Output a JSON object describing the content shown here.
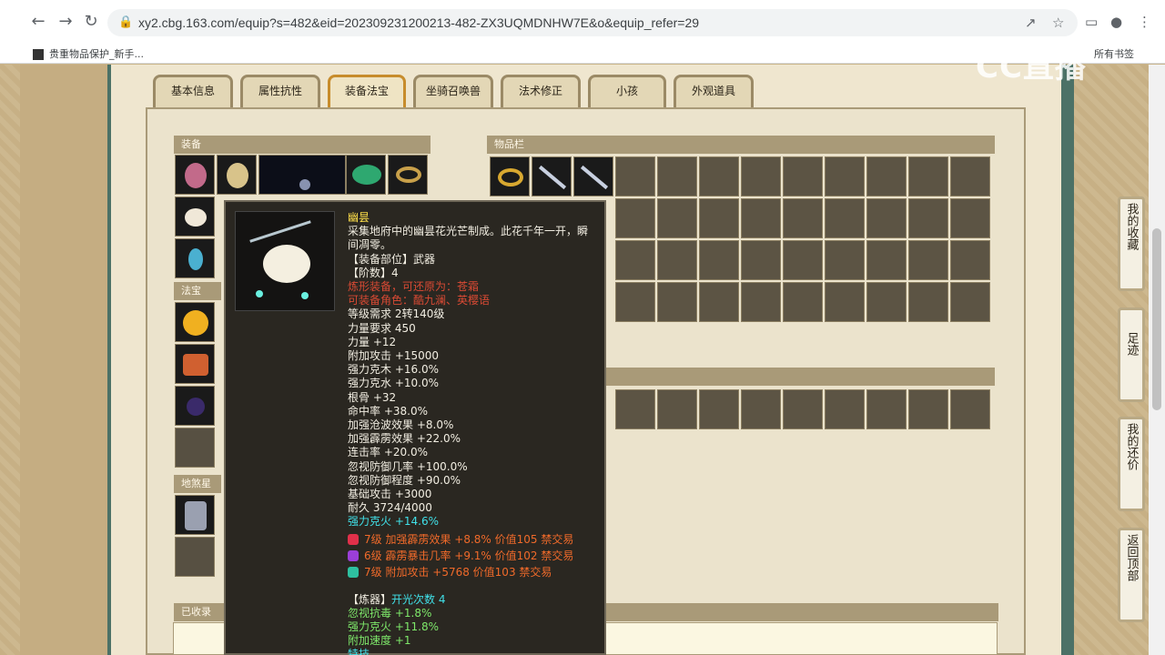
{
  "browser": {
    "url": "xy2.cbg.163.com/equip?s=482&eid=202309231200213-482-ZX3UQMDNHW7E&o&equip_refer=29",
    "bookmark": "贵重物品保护_新手...",
    "bookmark_right": "所有书签",
    "watermark": "CC直播"
  },
  "tabs": [
    "基本信息",
    "属性抗性",
    "装备法宝",
    "坐骑召唤兽",
    "法术修正",
    "小孩",
    "外观道具"
  ],
  "sections": {
    "equip": "装备",
    "inventory": "物品栏",
    "fabao": "法宝",
    "dishaxing": "地煞星",
    "collected": "已收录"
  },
  "tooltip": {
    "name": "幽昙",
    "desc1": "采集地府中的幽昙花光芒制成。此花千年一开，瞬",
    "desc2": "间凋零。",
    "part": "【装备部位】武器",
    "grade": "【阶数】4",
    "forge": "炼形装备，可还原为：苍霜",
    "roles": "可装备角色：酷九澜、英樱语",
    "level": "等级需求 2转140级",
    "str_req": "力量要求 450",
    "stats": [
      "力量 +12",
      "附加攻击 +15000",
      "强力克木 +16.0%",
      "强力克水 +10.0%",
      "根骨 +32",
      "命中率 +38.0%",
      "加强沧波效果 +8.0%",
      "加强霹雳效果 +22.0%",
      "连击率 +20.0%",
      "忽视防御几率 +100.0%",
      "忽视防御程度 +90.0%",
      "基础攻击 +3000",
      "耐久 3724/4000"
    ],
    "special": "强力克火 +14.6%",
    "gems": [
      {
        "text": "7级 加强霹雳效果 +8.8% 价值105 禁交易",
        "color": "#e0304a"
      },
      {
        "text": "6级 霹雳暴击几率 +9.1% 价值102 禁交易",
        "color": "#9b3fd8"
      },
      {
        "text": "7级 附加攻击 +5768 价值103 禁交易",
        "color": "#2ec0a0"
      }
    ],
    "refine_title": "【炼器】",
    "refine_count": "开光次数 4",
    "refine": [
      "忽视抗毒 +1.8%",
      "强力克火 +11.8%",
      "附加速度 +1"
    ],
    "trailing": "特技"
  },
  "float_buttons": [
    "我的收藏",
    "足迹",
    "我的还价",
    "返回顶部"
  ],
  "colors": {
    "accent_tab": "#c78c2c",
    "header": "#a99a78",
    "side": "#4c7166"
  }
}
